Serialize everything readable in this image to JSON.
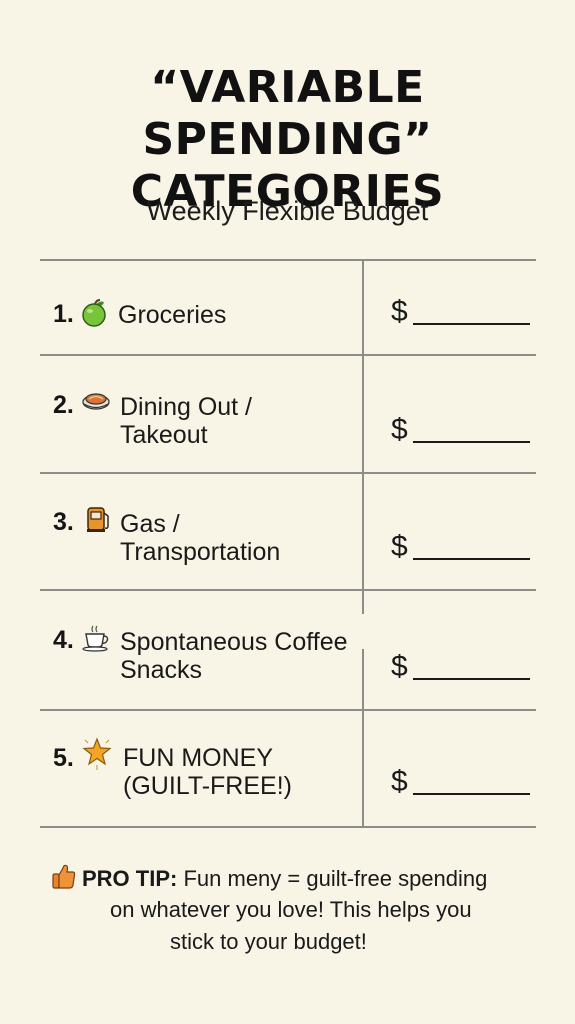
{
  "title": {
    "line1": "“VARIABLE SPENDING”",
    "line2": "CATEGORIES"
  },
  "subtitle": "Weekly Flexible Budget",
  "rows": [
    {
      "number": "1.",
      "icon": "green-apple-icon",
      "label_line1": "Groceries",
      "label_line2": "",
      "amount_prefix": "$"
    },
    {
      "number": "2.",
      "icon": "pie-dish-icon",
      "label_line1": "Dining Out /",
      "label_line2": "Takeout",
      "amount_prefix": "$"
    },
    {
      "number": "3.",
      "icon": "fuel-pump-icon",
      "label_line1": "Gas /",
      "label_line2": "Transportation",
      "amount_prefix": "$"
    },
    {
      "number": "4.",
      "icon": "coffee-cup-icon",
      "label_line1": "Spontaneous Coffee",
      "label_line2": "Snacks",
      "amount_prefix": "$"
    },
    {
      "number": "5.",
      "icon": "star-icon",
      "label_line1": "FUN MONEY",
      "label_line2": "(GUILT-FREE!)",
      "amount_prefix": "$"
    }
  ],
  "tip": {
    "icon": "thumbs-up-icon",
    "label": "PRO TIP:",
    "line1": "Fun meny = guilt-free spending",
    "line2": "on whatever you love! This helps you",
    "line3": "stick to your budget!"
  },
  "colors": {
    "background": "#f8f4e6",
    "rule": "#8c8c88",
    "text": "#161616"
  }
}
